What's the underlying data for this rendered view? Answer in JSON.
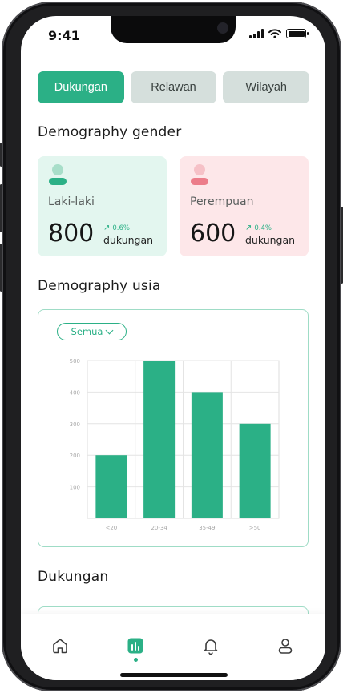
{
  "status_bar": {
    "time": "9:41"
  },
  "tabs": [
    {
      "label": "Dukungan",
      "active": true
    },
    {
      "label": "Relawan",
      "active": false
    },
    {
      "label": "Wilayah",
      "active": false
    }
  ],
  "gender": {
    "title": "Demography gender",
    "male": {
      "label": "Laki-laki",
      "value": "800",
      "growth": "0.6%",
      "unit": "dukungan",
      "icon": "person-icon"
    },
    "female": {
      "label": "Perempuan",
      "value": "600",
      "growth": "0.4%",
      "unit": "dukungan",
      "icon": "person-icon"
    }
  },
  "age": {
    "title": "Demography usia",
    "filter": {
      "selected": "Semua"
    }
  },
  "chart_data": {
    "type": "bar",
    "categories": [
      "<20",
      "20-34",
      "35-49",
      ">50"
    ],
    "values": [
      200,
      500,
      400,
      300
    ],
    "yticks": [
      100,
      200,
      300,
      400,
      500
    ],
    "ylim": [
      0,
      500
    ],
    "grid": true,
    "bar_color": "#2bb086"
  },
  "dukungan": {
    "title": "Dukungan"
  },
  "bottom_nav": [
    {
      "icon": "home-icon",
      "active": false
    },
    {
      "icon": "chart-icon",
      "active": true
    },
    {
      "icon": "bell-icon",
      "active": false
    },
    {
      "icon": "user-icon",
      "active": false
    }
  ],
  "colors": {
    "accent": "#2bb086",
    "female_accent": "#ec7d8a",
    "male_bg": "#e3f6ef",
    "female_bg": "#fde7e9"
  }
}
